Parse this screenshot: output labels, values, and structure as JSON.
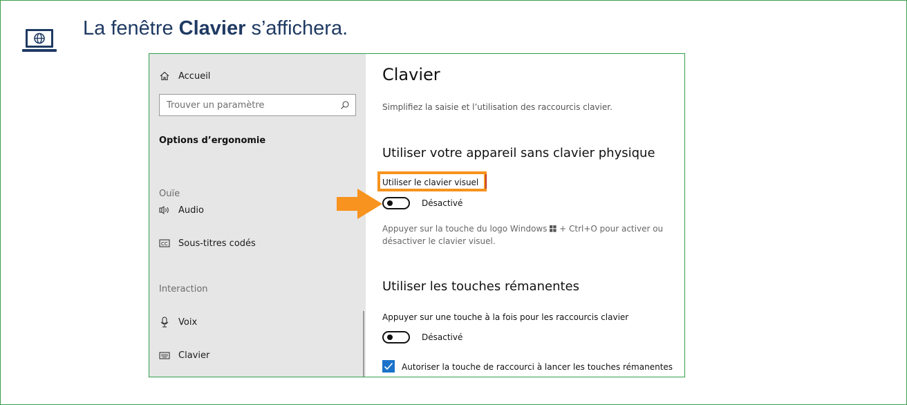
{
  "heading": {
    "prefix": "La fenêtre ",
    "bold": "Clavier",
    "suffix": " s’affichera."
  },
  "sidebar": {
    "home": "Accueil",
    "search_placeholder": "Trouver un paramètre",
    "section_title": "Options d’ergonomie",
    "group_hearing": "Ouïe",
    "audio": "Audio",
    "captions": "Sous-titres codés",
    "group_interaction": "Interaction",
    "voice": "Voix",
    "keyboard": "Clavier"
  },
  "main": {
    "title": "Clavier",
    "description": "Simplifiez la saisie et l’utilisation des raccourcis clavier.",
    "section1_title": "Utiliser votre appareil sans clavier physique",
    "osk_label": "Utiliser le clavier visuel",
    "osk_state": "Désactivé",
    "osk_note_before": "Appuyer sur la touche du logo Windows ",
    "osk_note_after": " + Ctrl+O pour activer ou désactiver le clavier visuel.",
    "section2_title": "Utiliser les touches rémanentes",
    "sticky_label": "Appuyer sur une touche à la fois pour les raccourcis clavier",
    "sticky_state": "Désactivé",
    "shortcut_checkbox_label": "Autoriser la touche de raccourci à lancer les touches rémanentes"
  },
  "colors": {
    "frame": "#3a9d4a",
    "heading": "#1f3a63",
    "highlight": "#f7931e",
    "checkbox": "#1a73c9"
  },
  "icons": [
    "laptop-globe-icon",
    "home-icon",
    "search-icon",
    "audio-icon",
    "captions-icon",
    "microphone-icon",
    "keyboard-icon",
    "pointer-arrow-icon",
    "windows-logo-icon",
    "checkmark-icon"
  ]
}
